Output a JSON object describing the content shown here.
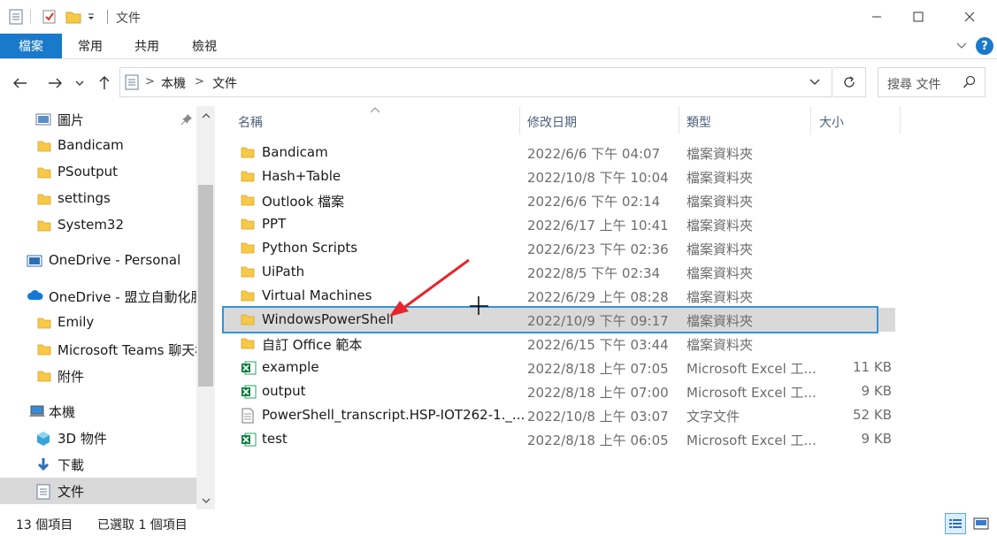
{
  "window": {
    "title": "文件",
    "minimize_icon": "minimize-icon",
    "maximize_icon": "maximize-icon",
    "close_icon": "close-icon"
  },
  "ribbon": {
    "tabs": [
      "檔案",
      "常用",
      "共用",
      "檢視"
    ],
    "accent": "#1979ca",
    "help_label": "?"
  },
  "address": {
    "crumbs": [
      "本機",
      "文件"
    ],
    "search_placeholder": "搜尋 文件"
  },
  "sidebar": {
    "items": [
      {
        "label": "圖片",
        "icon": "pictures-icon"
      },
      {
        "label": "Bandicam",
        "icon": "folder-icon"
      },
      {
        "label": "PSoutput",
        "icon": "folder-icon"
      },
      {
        "label": "settings",
        "icon": "folder-icon"
      },
      {
        "label": "System32",
        "icon": "folder-icon"
      },
      {
        "label": "OneDrive - Personal",
        "icon": "onedrive-personal-icon"
      },
      {
        "label": "OneDrive - 盟立自動化股",
        "icon": "onedrive-cloud-icon"
      },
      {
        "label": "Emily",
        "icon": "folder-icon"
      },
      {
        "label": "Microsoft Teams 聊天檔",
        "icon": "folder-icon"
      },
      {
        "label": "附件",
        "icon": "folder-icon"
      },
      {
        "label": "本機",
        "icon": "this-pc-icon"
      },
      {
        "label": "3D 物件",
        "icon": "3d-objects-icon"
      },
      {
        "label": "下載",
        "icon": "downloads-icon"
      },
      {
        "label": "文件",
        "icon": "documents-icon"
      }
    ]
  },
  "columns": [
    "名稱",
    "修改日期",
    "類型",
    "大小"
  ],
  "files": [
    {
      "name": "Bandicam",
      "date": "2022/6/6 下午 04:07",
      "type": "檔案資料夾",
      "size": "",
      "icon": "folder-icon"
    },
    {
      "name": "Hash+Table",
      "date": "2022/10/8 下午 10:04",
      "type": "檔案資料夾",
      "size": "",
      "icon": "folder-icon"
    },
    {
      "name": "Outlook 檔案",
      "date": "2022/6/6 下午 02:14",
      "type": "檔案資料夾",
      "size": "",
      "icon": "folder-icon"
    },
    {
      "name": "PPT",
      "date": "2022/6/17 上午 10:41",
      "type": "檔案資料夾",
      "size": "",
      "icon": "folder-icon"
    },
    {
      "name": "Python Scripts",
      "date": "2022/6/23 下午 02:36",
      "type": "檔案資料夾",
      "size": "",
      "icon": "folder-icon"
    },
    {
      "name": "UiPath",
      "date": "2022/8/5 下午 02:34",
      "type": "檔案資料夾",
      "size": "",
      "icon": "folder-icon"
    },
    {
      "name": "Virtual Machines",
      "date": "2022/6/29 上午 08:28",
      "type": "檔案資料夾",
      "size": "",
      "icon": "folder-icon"
    },
    {
      "name": "WindowsPowerShell",
      "date": "2022/10/9 下午 09:17",
      "type": "檔案資料夾",
      "size": "",
      "icon": "folder-icon"
    },
    {
      "name": "自訂 Office 範本",
      "date": "2022/6/15 下午 03:44",
      "type": "檔案資料夾",
      "size": "",
      "icon": "folder-icon"
    },
    {
      "name": "example",
      "date": "2022/8/18 上午 07:05",
      "type": "Microsoft Excel 工...",
      "size": "11 KB",
      "icon": "excel-icon"
    },
    {
      "name": "output",
      "date": "2022/8/18 上午 07:00",
      "type": "Microsoft Excel 工...",
      "size": "9 KB",
      "icon": "excel-icon"
    },
    {
      "name": "PowerShell_transcript.HSP-IOT262-1._...",
      "date": "2022/10/8 上午 03:07",
      "type": "文字文件",
      "size": "52 KB",
      "icon": "text-file-icon"
    },
    {
      "name": "test",
      "date": "2022/8/18 上午 06:05",
      "type": "Microsoft Excel 工...",
      "size": "9 KB",
      "icon": "excel-icon"
    }
  ],
  "selected_file": "WindowsPowerShell",
  "status": {
    "count": "13 個項目",
    "selected": "已選取 1 個項目"
  },
  "annotation": {
    "arrow_color": "#e8252a"
  }
}
